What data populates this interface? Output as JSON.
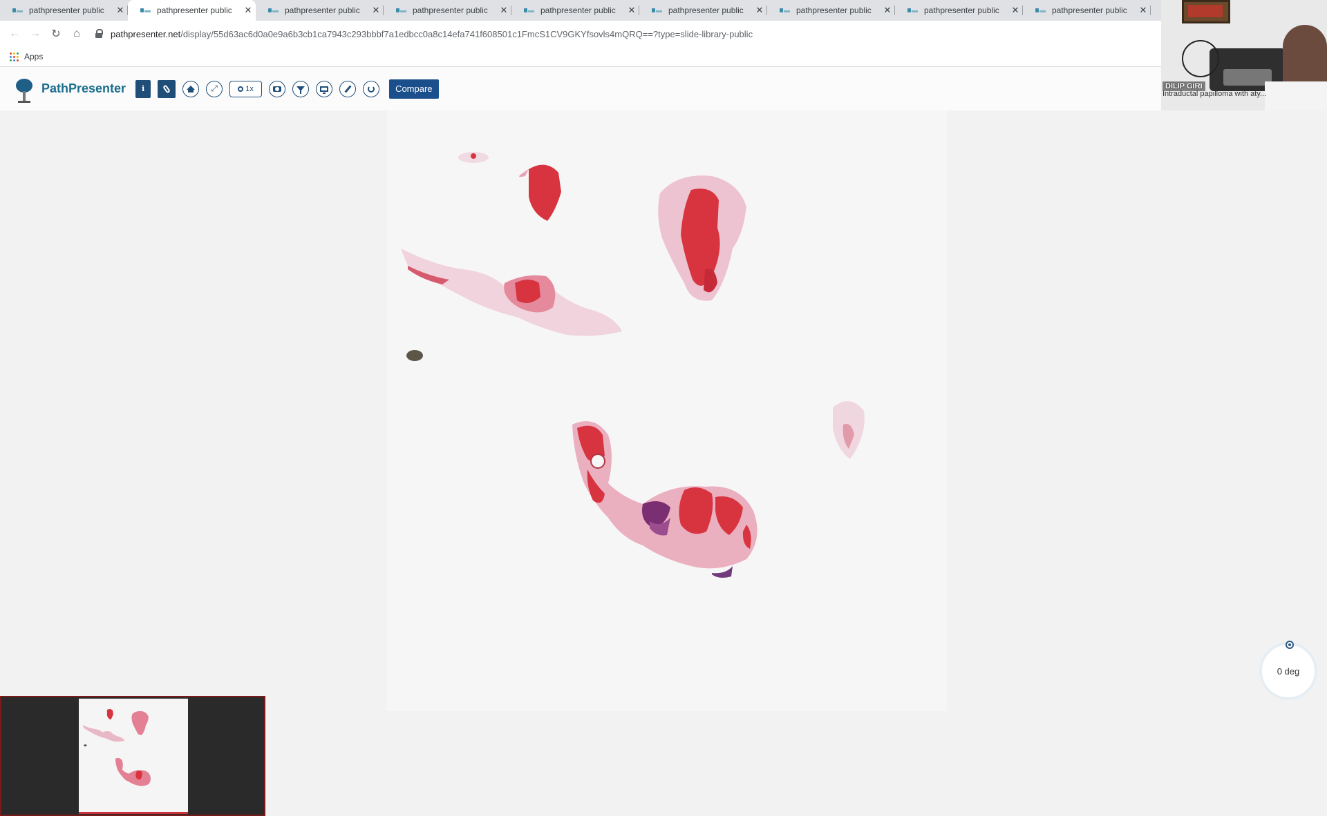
{
  "browser": {
    "tabs": [
      {
        "title": "pathpresenter public",
        "close": "✕",
        "active": false
      },
      {
        "title": "pathpresenter public",
        "close": "✕",
        "active": true
      },
      {
        "title": "pathpresenter public",
        "close": "✕",
        "active": false
      },
      {
        "title": "pathpresenter public",
        "close": "✕",
        "active": false
      },
      {
        "title": "pathpresenter public",
        "close": "✕",
        "active": false
      },
      {
        "title": "pathpresenter public",
        "close": "✕",
        "active": false
      },
      {
        "title": "pathpresenter public",
        "close": "✕",
        "active": false
      },
      {
        "title": "pathpresenter public",
        "close": "✕",
        "active": false
      },
      {
        "title": "pathpresenter public",
        "close": "✕",
        "active": false
      }
    ],
    "nav": {
      "back": "←",
      "forward": "→",
      "reload": "↻",
      "home": "⌂"
    },
    "url": {
      "host": "pathpresenter.net",
      "path": "/display/55d63ac6d0a0e9a6b3cb1ca7943c293bbbf7a1edbcc0a8c14efa741f608501c1FmcS1CV9GKYfsovls4mQRQ==?type=slide-library-public"
    },
    "bookmarks": {
      "apps_label": "Apps",
      "apps_icon_colors": [
        "#ea4335",
        "#fbbc05",
        "#34a853",
        "#4285f4",
        "#ea4335",
        "#fbbc05",
        "#34a853",
        "#4285f4",
        "#ea4335"
      ]
    }
  },
  "app": {
    "brand": "PathPresenter",
    "toolbar": {
      "info_icon": "i",
      "zoom_label": "1x",
      "compare_label": "Compare"
    }
  },
  "viewer": {
    "rotation_label": "0 deg"
  },
  "video_overlay": {
    "name": "DILIP GIRI",
    "caption": "Intraductal papilloma with aty..."
  },
  "colors": {
    "accent": "#1a4f8b",
    "brand_text": "#1b6e8e",
    "tissue_red": "#d8343f",
    "tissue_pink": "#e7a3b6",
    "tissue_purple": "#7a2f73"
  }
}
